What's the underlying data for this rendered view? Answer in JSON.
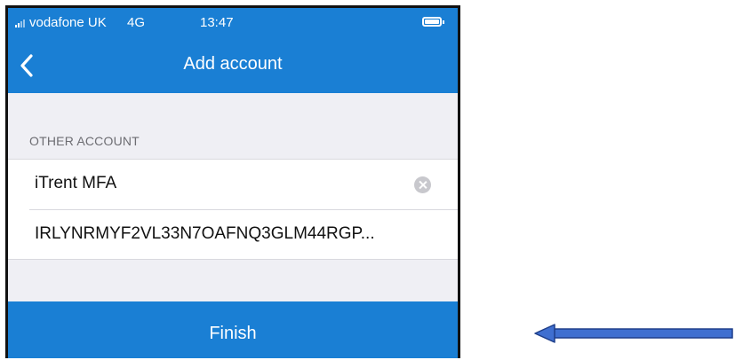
{
  "status_bar": {
    "carrier": "vodafone UK",
    "network": "4G",
    "time": "13:47",
    "signal_bars_icon": "signal-icon",
    "battery_icon": "battery-icon"
  },
  "nav": {
    "title": "Add account",
    "back_icon": "chevron-left-icon"
  },
  "section": {
    "header": "OTHER ACCOUNT"
  },
  "fields": {
    "account_name": "iTrent MFA",
    "secret_key": "IRLYNRMYF2VL33N7OAFNQ3GLM44RGP..."
  },
  "actions": {
    "finish_label": "Finish"
  },
  "colors": {
    "brand_blue": "#1a7fd4",
    "background_gray": "#efeff4",
    "annotation_arrow": "#3f6fd0"
  }
}
